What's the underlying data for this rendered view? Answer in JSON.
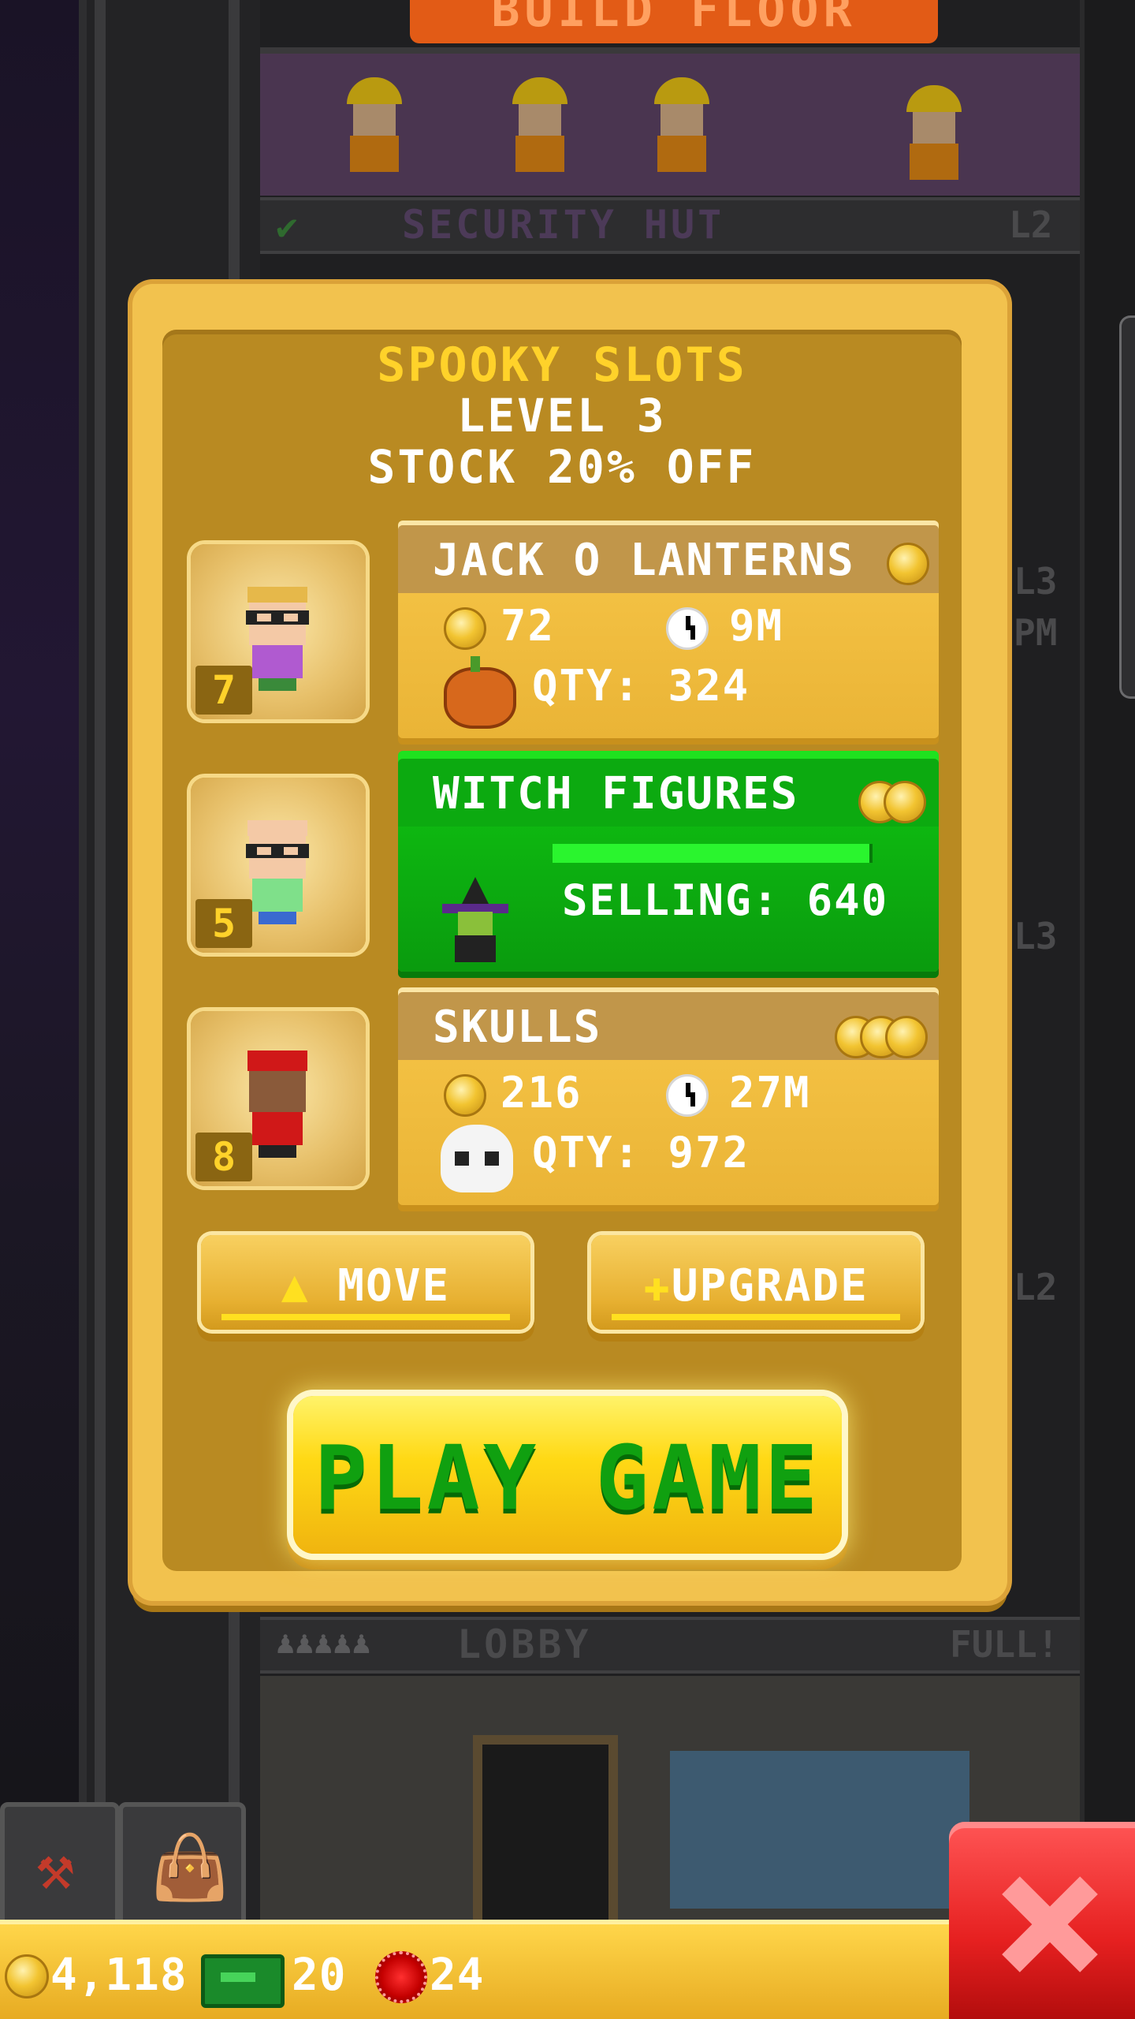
{
  "background": {
    "build_floor_label": "BUILD FLOOR",
    "floor_security": {
      "name": "SECURITY HUT",
      "level": "L2"
    },
    "floor_lobby": {
      "name": "LOBBY",
      "status": "FULL!"
    },
    "side_levels": [
      "L3",
      "PM",
      "L3",
      "L2"
    ]
  },
  "popup": {
    "title": "SPOOKY SLOTS",
    "level": "LEVEL 3",
    "discount": "STOCK 20% OFF",
    "workers": [
      {
        "level": "7",
        "shirt_color": "#b05ad0",
        "hair_color": "#e6b84a"
      },
      {
        "level": "5",
        "shirt_color": "#7fe08a",
        "hair_color": "#f4c9a6"
      },
      {
        "level": "8",
        "shirt_color": "#d01818",
        "hair_color": "#d01818"
      }
    ],
    "items": [
      {
        "name": "JACK O LANTERNS",
        "cost": "72",
        "time": "9M",
        "qty_label": "QTY: 324",
        "icon": "pumpkin-icon",
        "state": "stocked"
      },
      {
        "name": "WITCH FIGURES",
        "selling_label": "SELLING: 640",
        "progress": 0.99,
        "icon": "witch-icon",
        "state": "selling"
      },
      {
        "name": "SKULLS",
        "cost": "216",
        "time": "27M",
        "qty_label": "QTY: 972",
        "icon": "skull-icon",
        "state": "stocked"
      }
    ],
    "buttons": {
      "move": "MOVE",
      "upgrade": "UPGRADE",
      "play": "PLAY GAME"
    }
  },
  "bottom_bar": {
    "coins": "4,118",
    "bux": "20",
    "chips": "24"
  },
  "colors": {
    "popup_gold": "#f2c24e",
    "popup_inner": "#b98a22",
    "title_yellow": "#ffd22a",
    "selling_green": "#0fc412",
    "close_red": "#e62020"
  }
}
